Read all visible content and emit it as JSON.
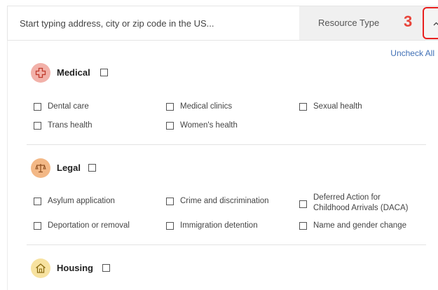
{
  "search": {
    "placeholder": "Start typing address, city or zip code in the US..."
  },
  "resource_type": {
    "label": "Resource Type",
    "step_number": "3"
  },
  "uncheck_all": "Uncheck All",
  "colors": {
    "medical": "#f2b1a9",
    "legal": "#f3b886",
    "housing": "#f7e2a0",
    "accent": "#e8443a",
    "link": "#3f6fb5"
  },
  "sections": [
    {
      "title": "Medical",
      "icon": "medical-cross-icon",
      "options": [
        "Dental care",
        "Medical clinics",
        "Sexual health",
        "Trans health",
        "Women's health"
      ]
    },
    {
      "title": "Legal",
      "icon": "scales-icon",
      "options": [
        "Asylum application",
        "Crime and discrimination",
        "Deferred Action for Childhood Arrivals (DACA)",
        "Deportation or removal",
        "Immigration detention",
        "Name and gender change"
      ]
    },
    {
      "title": "Housing",
      "icon": "house-icon",
      "options": []
    }
  ]
}
